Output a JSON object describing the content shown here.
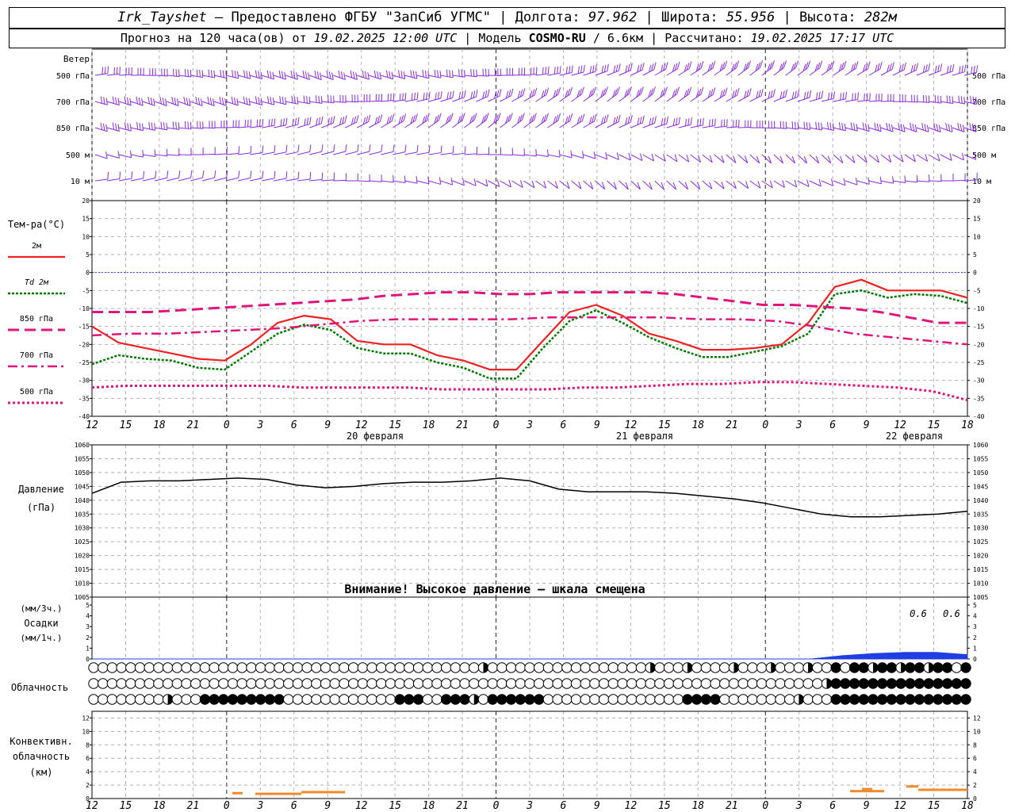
{
  "header": {
    "station": "Irk_Tayshet",
    "dash": " — ",
    "provider": "Предоставлено ФГБУ \"ЗапСиб УГМС\"",
    "lon_label": "Долгота:",
    "lon_value": "97.962",
    "lat_label": "Широта:",
    "lat_value": "55.956",
    "alt_label": "Высота:",
    "alt_value": "282м",
    "forecast_prefix": "Прогноз на 120 часа(ов) от",
    "forecast_start": "19.02.2025 12:00 UTC",
    "model_label": "Модель",
    "model_name": "COSMO-RU",
    "model_res": "/ 6.6км",
    "calc_label": "Рассчитано:",
    "calc_time": "19.02.2025 17:17 UTC"
  },
  "colors": {
    "t2m": "#ee2222",
    "td2m": "#007a00",
    "t850": "#e0157a",
    "t700": "#e0157a",
    "t500": "#e0157a",
    "zero_line": "#3344dd",
    "wind": "#8a2be2",
    "pressure": "#000000",
    "precip": "#1f3fe0",
    "convective": "#f08a2a",
    "grid": "#b0b0b0"
  },
  "x_axis": {
    "hour_ticks": [
      "12",
      "15",
      "18",
      "21",
      "0",
      "3",
      "6",
      "9",
      "12",
      "15",
      "18",
      "21",
      "0",
      "3",
      "6",
      "9",
      "12",
      "15",
      "18",
      "21",
      "0",
      "3",
      "6",
      "9",
      "12",
      "15",
      "18"
    ],
    "date_labels": [
      "20 февраля",
      "21 февраля",
      "22 февраля"
    ]
  },
  "wind_panel": {
    "title": "Ветер",
    "levels": [
      "500 гПа",
      "700 гПа",
      "850 гПа",
      "500 м",
      "10  м"
    ],
    "levels_right": [
      "500 гПа",
      "700 гПа",
      "850 гПа",
      "500 м",
      "10  м"
    ]
  },
  "temp_panel": {
    "title": "Тем-ра(°C)",
    "legend": [
      {
        "label": "2м",
        "key": "t2m"
      },
      {
        "label": "Td 2м",
        "key": "td2m"
      },
      {
        "label": "850 гПа",
        "key": "t850"
      },
      {
        "label": "700 гПа",
        "key": "t700"
      },
      {
        "label": "500 гПа",
        "key": "t500"
      }
    ],
    "y_ticks": [
      "20",
      "15",
      "10",
      "5",
      "0",
      "-5",
      "-10",
      "-15",
      "-20",
      "-25",
      "-30",
      "-35",
      "-40"
    ]
  },
  "pressure_panel": {
    "title": "Давление",
    "unit": "(гПа)",
    "y_ticks": [
      "1060",
      "1055",
      "1050",
      "1045",
      "1040",
      "1035",
      "1030",
      "1025",
      "1020",
      "1015",
      "1010",
      "1005"
    ],
    "warning": "Внимание! Высокое давление – шкала смещена"
  },
  "precip_panel": {
    "unit3": "(мм/3ч.)",
    "title": "Осадки",
    "unit1": "(мм/1ч.)",
    "y_ticks": [
      "5",
      "4",
      "3",
      "2",
      "1",
      "0"
    ],
    "annotations": [
      "0.6",
      "0.6"
    ]
  },
  "cloud_panel": {
    "title": "Облачность"
  },
  "conv_panel": {
    "title1": "Конвективн.",
    "title2": "облачность",
    "unit": "(км)",
    "y_ticks": [
      "12",
      "10",
      "8",
      "6",
      "4",
      "2",
      "0"
    ]
  },
  "chart_data": {
    "type": "line",
    "x_hours": [
      0,
      3,
      6,
      9,
      12,
      15,
      18,
      21,
      24,
      27,
      30,
      33,
      36,
      39,
      42,
      45,
      48,
      51,
      54,
      57,
      60,
      63,
      66,
      69,
      72,
      75,
      78
    ],
    "series": [
      {
        "name": "2м",
        "values": [
          -15,
          -19.5,
          -21,
          -22.5,
          -24,
          -24.5,
          -20,
          -14,
          -12,
          -13,
          -19,
          -20,
          -20,
          -23,
          -24.5,
          -27,
          -27,
          -19,
          -11,
          -9,
          -12,
          -17,
          -19,
          -21.5,
          -21.5,
          -21,
          -20,
          -14,
          -4,
          -2,
          -5,
          -5,
          -5,
          -7
        ]
      },
      {
        "name": "Td 2м",
        "values": [
          -25.5,
          -23,
          -24,
          -24.5,
          -26.5,
          -27,
          -22,
          -17,
          -14.5,
          -16,
          -21,
          -22.5,
          -22.5,
          -25,
          -26.5,
          -29.5,
          -29.5,
          -21,
          -13.5,
          -10.5,
          -14,
          -18,
          -21,
          -23.5,
          -23.5,
          -22,
          -20.5,
          -17,
          -6,
          -5,
          -7,
          -6,
          -6.5,
          -8.5
        ]
      },
      {
        "name": "850 гПа",
        "values": [
          -11,
          -11,
          -11,
          -10.5,
          -10,
          -9.5,
          -9,
          -8.5,
          -8,
          -7.5,
          -6.5,
          -6,
          -5.5,
          -5.5,
          -6,
          -6,
          -5.5,
          -5.5,
          -5.5,
          -5.5,
          -6,
          -7,
          -8,
          -9,
          -9,
          -9.5,
          -10,
          -11,
          -12.5,
          -14,
          -14
        ]
      },
      {
        "name": "700 гПа",
        "values": [
          -17.5,
          -17,
          -17,
          -16.5,
          -16,
          -15.5,
          -14.5,
          -13.5,
          -13,
          -13,
          -13,
          -13,
          -12.5,
          -12.5,
          -12.5,
          -12.5,
          -13,
          -13,
          -13.5,
          -15,
          -17,
          -18,
          -19,
          -20
        ]
      },
      {
        "name": "500 гПа",
        "values": [
          -32,
          -31.5,
          -31.5,
          -31.5,
          -31.5,
          -31.5,
          -32,
          -32,
          -32,
          -32,
          -32.5,
          -32.5,
          -32.5,
          -32.5,
          -32,
          -32,
          -31.5,
          -31,
          -31,
          -30.5,
          -30.5,
          -31,
          -31.5,
          -32,
          -33,
          -35.5
        ]
      },
      {
        "name": "Давление",
        "values": [
          1042.5,
          1046.5,
          1047,
          1047,
          1047.5,
          1048,
          1047.5,
          1045.5,
          1044.5,
          1045,
          1046,
          1046.5,
          1046.5,
          1047,
          1048,
          1047,
          1044,
          1043,
          1043,
          1043,
          1042.5,
          1041.5,
          1040.5,
          1039,
          1037,
          1035,
          1034,
          1034,
          1034.5,
          1035,
          1036
        ]
      },
      {
        "name": "Осадки",
        "values": [
          0,
          0,
          0,
          0,
          0,
          0,
          0,
          0,
          0,
          0,
          0,
          0,
          0,
          0,
          0,
          0,
          0,
          0,
          0,
          0,
          0,
          0,
          0,
          0,
          0.3,
          0.5,
          0.6,
          0.6,
          0.4
        ]
      }
    ],
    "ylim_temp": [
      -40,
      20
    ],
    "ylim_pressure": [
      1005,
      1060
    ],
    "ylim_precip": [
      0,
      5
    ],
    "ylim_convective": [
      0,
      13
    ],
    "grid": true
  }
}
